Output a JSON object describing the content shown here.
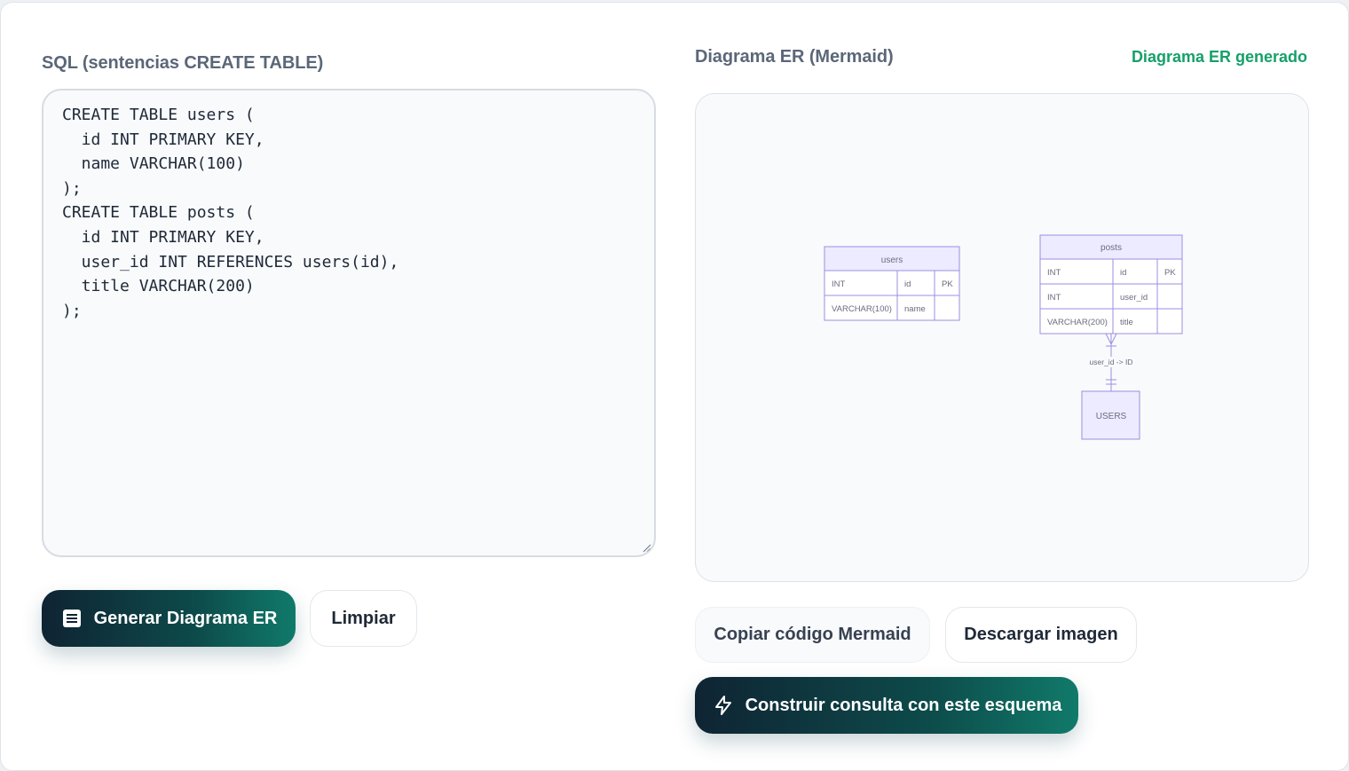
{
  "sql_panel": {
    "label": "SQL (sentencias CREATE TABLE)",
    "code": "CREATE TABLE users (\n  id INT PRIMARY KEY,\n  name VARCHAR(100)\n);\nCREATE TABLE posts (\n  id INT PRIMARY KEY,\n  user_id INT REFERENCES users(id),\n  title VARCHAR(200)\n);"
  },
  "er_panel": {
    "label": "Diagrama ER (Mermaid)",
    "status": "Diagrama ER generado",
    "status_color": "#16a06a"
  },
  "diagram": {
    "entities": [
      {
        "name": "users",
        "rows": [
          {
            "type": "INT",
            "field": "id",
            "key": "PK"
          },
          {
            "type": "VARCHAR(100)",
            "field": "name",
            "key": ""
          }
        ]
      },
      {
        "name": "posts",
        "rows": [
          {
            "type": "INT",
            "field": "id",
            "key": "PK"
          },
          {
            "type": "INT",
            "field": "user_id",
            "key": ""
          },
          {
            "type": "VARCHAR(200)",
            "field": "title",
            "key": ""
          }
        ]
      },
      {
        "name": "USERS",
        "rows": []
      }
    ],
    "relationship_label": "user_id -> ID",
    "line_color": "#9b8fe0",
    "header_fill": "#ecebff"
  },
  "buttons": {
    "generate": {
      "label": "Generar Diagrama ER",
      "icon": "list-icon"
    },
    "clear": {
      "label": "Limpiar"
    },
    "copy": {
      "label": "Copiar código Mermaid"
    },
    "download": {
      "label": "Descargar imagen"
    },
    "build": {
      "label": "Construir consulta con este esquema",
      "icon": "lightning-icon"
    }
  },
  "colors": {
    "primary_gradient_start": "#0f2433",
    "primary_gradient_end": "#107a6a",
    "label_color": "#5b6778"
  }
}
